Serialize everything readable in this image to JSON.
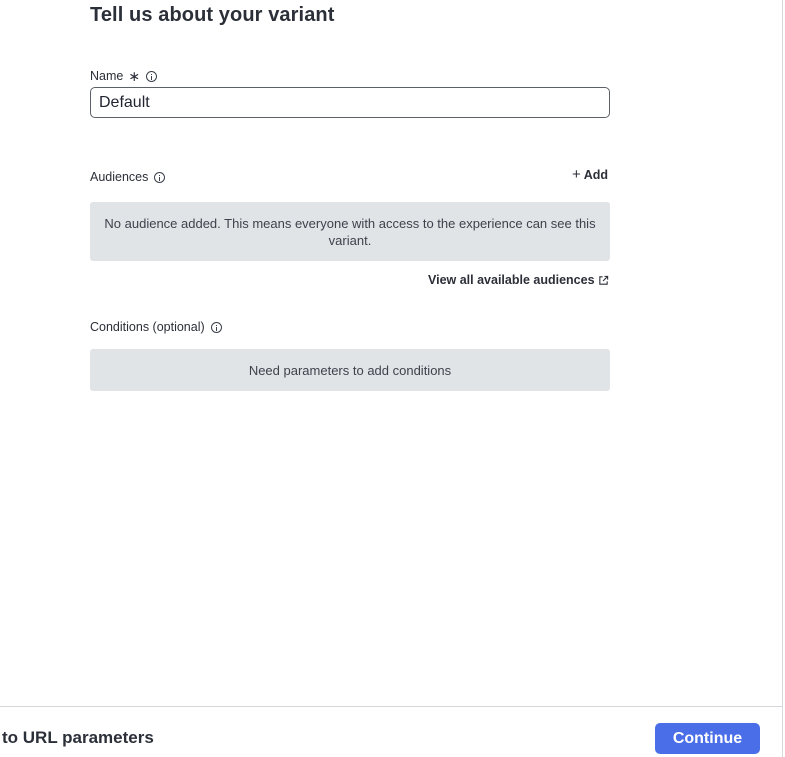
{
  "form": {
    "title": "Tell us about your variant",
    "name": {
      "label": "Name",
      "required_mark": "∗",
      "value": "Default"
    },
    "audiences": {
      "label": "Audiences",
      "add_label": "Add",
      "empty_message": "No audience added. This means everyone with access to the experience can see this variant.",
      "view_all_label": "View all available audiences"
    },
    "conditions": {
      "label": "Conditions (optional)",
      "empty_message": "Need parameters to add conditions"
    }
  },
  "footer": {
    "left_text": "to URL parameters",
    "continue_label": "Continue"
  },
  "colors": {
    "primary_button": "#4a6ee8",
    "empty_box": "#e1e4e7"
  }
}
